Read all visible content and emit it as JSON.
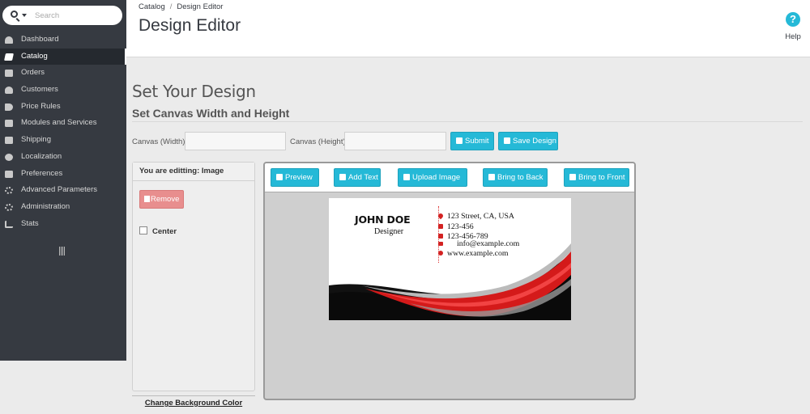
{
  "search": {
    "placeholder": "Search"
  },
  "sidebar": {
    "items": [
      {
        "label": "Dashboard",
        "icon": "dashboard-icon"
      },
      {
        "label": "Catalog",
        "icon": "book-icon",
        "active": true
      },
      {
        "label": "Orders",
        "icon": "credit-card-icon"
      },
      {
        "label": "Customers",
        "icon": "users-icon"
      },
      {
        "label": "Price Rules",
        "icon": "tags-icon"
      },
      {
        "label": "Modules and Services",
        "icon": "puzzle-icon"
      },
      {
        "label": "Shipping",
        "icon": "truck-icon"
      },
      {
        "label": "Localization",
        "icon": "globe-icon"
      },
      {
        "label": "Preferences",
        "icon": "wrench-icon"
      },
      {
        "label": "Advanced Parameters",
        "icon": "cogs-icon"
      },
      {
        "label": "Administration",
        "icon": "gear-icon"
      },
      {
        "label": "Stats",
        "icon": "bar-chart-icon"
      }
    ]
  },
  "header": {
    "breadcrumb": [
      "Catalog",
      "Design Editor"
    ],
    "title": "Design Editor",
    "help_label": "Help",
    "help_glyph": "?"
  },
  "main": {
    "heading": "Set Your Design",
    "subheading": "Set Canvas Width and Height",
    "width_label": "Canvas (Width):",
    "height_label": "Canvas (Height):",
    "width_value": "",
    "height_value": "",
    "submit_label": "Submit",
    "save_label": "Save Design"
  },
  "editor": {
    "editing_label": "You are editting: Image",
    "remove_label": "Remove",
    "center_label": "Center",
    "center_checked": false,
    "bg_link": "Change Background Color"
  },
  "toolbar": {
    "preview": "Preview",
    "add_text": "Add Text",
    "upload": "Upload Image",
    "back": "Bring to Back",
    "front": "Bring to Front"
  },
  "card": {
    "name": "JOHN DOE",
    "role": "Designer",
    "address": "123 Street, CA, USA",
    "phone": "123-456",
    "mobile": "123-456-789",
    "email": "info@example.com",
    "website": "www.example.com"
  },
  "colors": {
    "sidebar_bg": "#363a41",
    "accent": "#25b9d7",
    "danger": "#e88e8e",
    "card_red": "#d32222"
  }
}
